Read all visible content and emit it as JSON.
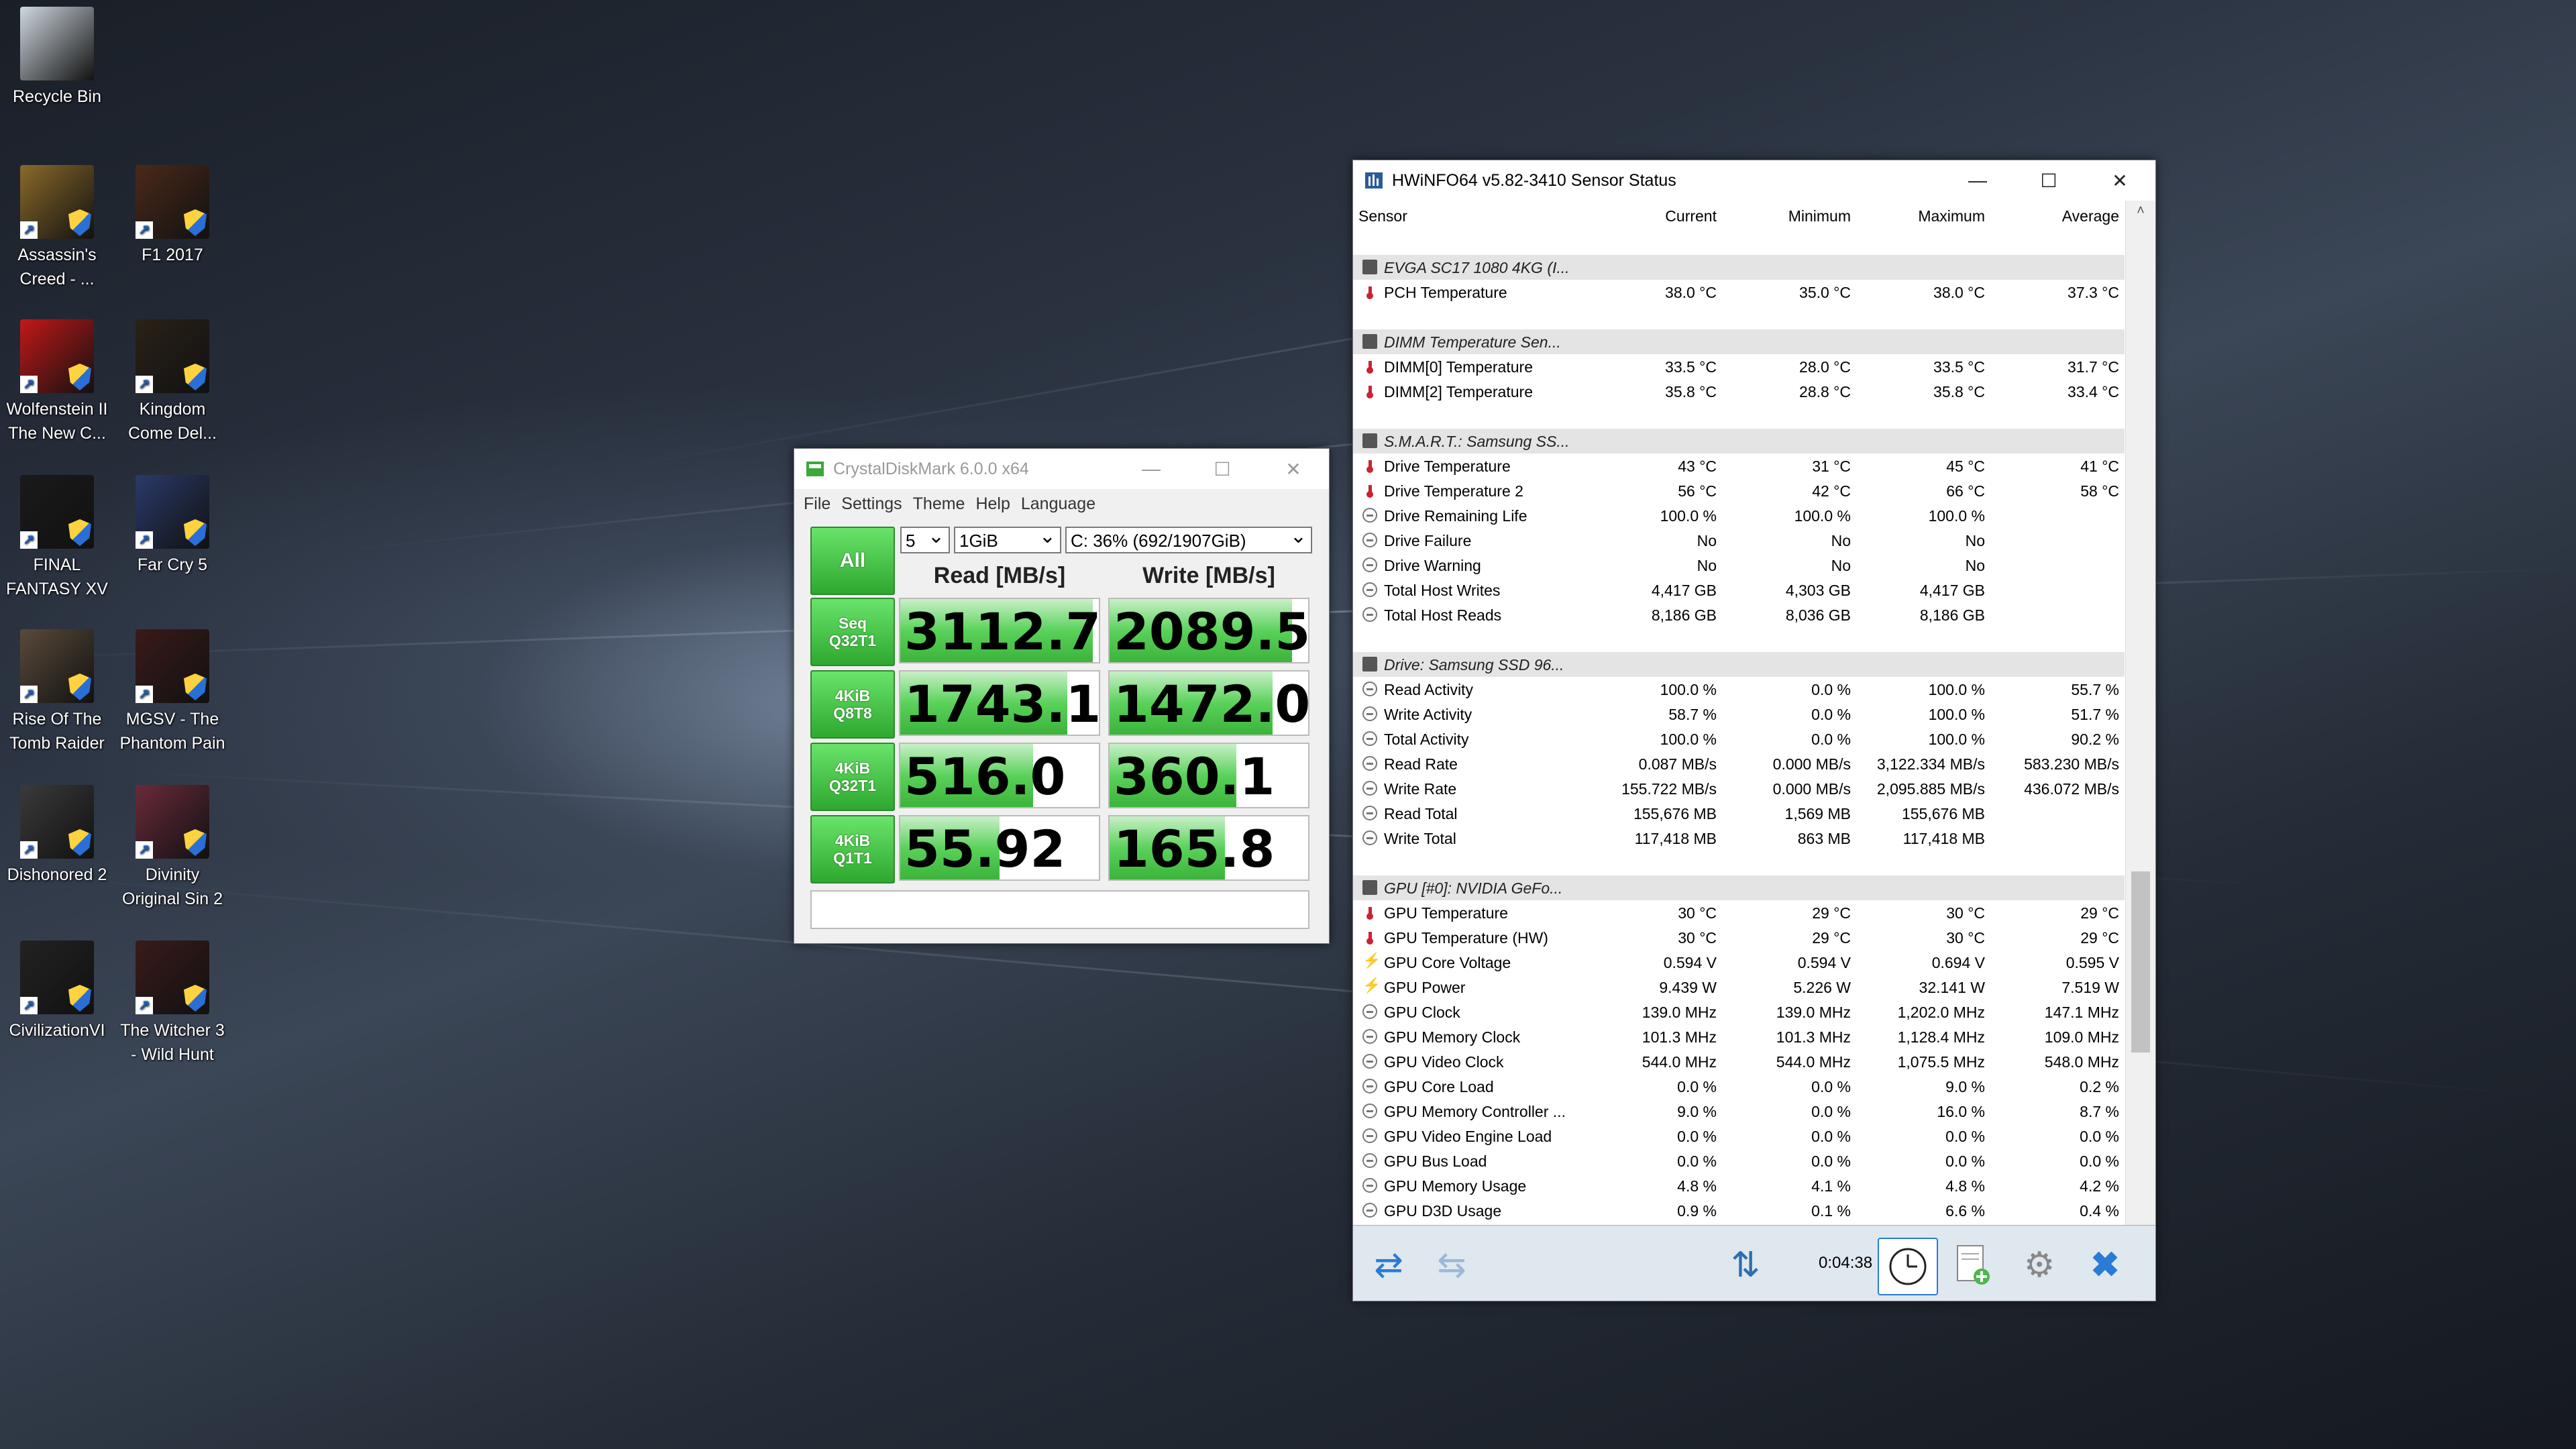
{
  "desktop": {
    "icons": [
      {
        "label": "Recycle Bin",
        "color": "#cfd8e0"
      },
      {
        "label": "Assassin's Creed - ...",
        "color": "#8a6a2a"
      },
      {
        "label": "F1 2017",
        "color": "#4a2a1a"
      },
      {
        "label": "Wolfenstein II The New C...",
        "color": "#c21818"
      },
      {
        "label": "Kingdom Come Del...",
        "color": "#2a2218"
      },
      {
        "label": "FINAL FANTASY XV",
        "color": "#1a1a1a"
      },
      {
        "label": "Far Cry 5",
        "color": "#2a3a6a"
      },
      {
        "label": "Rise Of The Tomb Raider",
        "color": "#5a4a3a"
      },
      {
        "label": "MGSV - The Phantom Pain",
        "color": "#3a1a1a"
      },
      {
        "label": "Dishonored 2",
        "color": "#3a3a3a"
      },
      {
        "label": "Divinity Original Sin 2",
        "color": "#6a2a3a"
      },
      {
        "label": "CivilizationVI",
        "color": "#222222"
      },
      {
        "label": "The Witcher 3 - Wild Hunt",
        "color": "#3a1a1a"
      }
    ]
  },
  "cdm": {
    "title": "CrystalDiskMark 6.0.0 x64",
    "menu": [
      "File",
      "Settings",
      "Theme",
      "Help",
      "Language"
    ],
    "all_label": "All",
    "count": "5",
    "size": "1GiB",
    "drive": "C: 36% (692/1907GiB)",
    "read_header": "Read [MB/s]",
    "write_header": "Write [MB/s]",
    "tests": [
      {
        "l1": "Seq",
        "l2": "Q32T1",
        "read": "3112.7",
        "write": "2089.5",
        "read_fill": 0.97,
        "write_fill": 0.92
      },
      {
        "l1": "4KiB",
        "l2": "Q8T8",
        "read": "1743.1",
        "write": "1472.0",
        "read_fill": 0.84,
        "write_fill": 0.82
      },
      {
        "l1": "4KiB",
        "l2": "Q32T1",
        "read": "516.0",
        "write": "360.1",
        "read_fill": 0.67,
        "write_fill": 0.64
      },
      {
        "l1": "4KiB",
        "l2": "Q1T1",
        "read": "55.92",
        "write": "165.8",
        "read_fill": 0.5,
        "write_fill": 0.58
      }
    ]
  },
  "hw": {
    "title": "HWiNFO64 v5.82-3410 Sensor Status",
    "columns": [
      "Sensor",
      "Current",
      "Minimum",
      "Maximum",
      "Average"
    ],
    "rows": [
      {
        "type": "blank"
      },
      {
        "type": "group",
        "name": "EVGA SC17 1080 4KG (I..."
      },
      {
        "icon": "therm",
        "name": "PCH Temperature",
        "v": [
          "38.0 °C",
          "35.0 °C",
          "38.0 °C",
          "37.3 °C"
        ]
      },
      {
        "type": "blank"
      },
      {
        "type": "group",
        "name": "DIMM Temperature Sen..."
      },
      {
        "icon": "therm",
        "name": "DIMM[0] Temperature",
        "v": [
          "33.5 °C",
          "28.0 °C",
          "33.5 °C",
          "31.7 °C"
        ]
      },
      {
        "icon": "therm",
        "name": "DIMM[2] Temperature",
        "v": [
          "35.8 °C",
          "28.8 °C",
          "35.8 °C",
          "33.4 °C"
        ]
      },
      {
        "type": "blank"
      },
      {
        "type": "group",
        "name": "S.M.A.R.T.: Samsung SS..."
      },
      {
        "icon": "therm",
        "name": "Drive Temperature",
        "v": [
          "43 °C",
          "31 °C",
          "45 °C",
          "41 °C"
        ]
      },
      {
        "icon": "therm",
        "name": "Drive Temperature 2",
        "v": [
          "56 °C",
          "42 °C",
          "66 °C",
          "58 °C"
        ]
      },
      {
        "icon": "circ",
        "name": "Drive Remaining Life",
        "v": [
          "100.0 %",
          "100.0 %",
          "100.0 %",
          ""
        ]
      },
      {
        "icon": "circ",
        "name": "Drive Failure",
        "v": [
          "No",
          "No",
          "No",
          ""
        ]
      },
      {
        "icon": "circ",
        "name": "Drive Warning",
        "v": [
          "No",
          "No",
          "No",
          ""
        ]
      },
      {
        "icon": "circ",
        "name": "Total Host Writes",
        "v": [
          "4,417 GB",
          "4,303 GB",
          "4,417 GB",
          ""
        ]
      },
      {
        "icon": "circ",
        "name": "Total Host Reads",
        "v": [
          "8,186 GB",
          "8,036 GB",
          "8,186 GB",
          ""
        ]
      },
      {
        "type": "blank"
      },
      {
        "type": "group",
        "name": "Drive: Samsung SSD 96..."
      },
      {
        "icon": "circ",
        "name": "Read Activity",
        "v": [
          "100.0 %",
          "0.0 %",
          "100.0 %",
          "55.7 %"
        ]
      },
      {
        "icon": "circ",
        "name": "Write Activity",
        "v": [
          "58.7 %",
          "0.0 %",
          "100.0 %",
          "51.7 %"
        ]
      },
      {
        "icon": "circ",
        "name": "Total Activity",
        "v": [
          "100.0 %",
          "0.0 %",
          "100.0 %",
          "90.2 %"
        ]
      },
      {
        "icon": "circ",
        "name": "Read Rate",
        "v": [
          "0.087 MB/s",
          "0.000 MB/s",
          "3,122.334 MB/s",
          "583.230 MB/s"
        ]
      },
      {
        "icon": "circ",
        "name": "Write Rate",
        "v": [
          "155.722 MB/s",
          "0.000 MB/s",
          "2,095.885 MB/s",
          "436.072 MB/s"
        ]
      },
      {
        "icon": "circ",
        "name": "Read Total",
        "v": [
          "155,676 MB",
          "1,569 MB",
          "155,676 MB",
          ""
        ]
      },
      {
        "icon": "circ",
        "name": "Write Total",
        "v": [
          "117,418 MB",
          "863 MB",
          "117,418 MB",
          ""
        ]
      },
      {
        "type": "blank"
      },
      {
        "type": "group",
        "name": "GPU [#0]: NVIDIA GeFo..."
      },
      {
        "icon": "therm",
        "name": "GPU Temperature",
        "v": [
          "30 °C",
          "29 °C",
          "30 °C",
          "29 °C"
        ]
      },
      {
        "icon": "therm",
        "name": "GPU Temperature (HW)",
        "v": [
          "30 °C",
          "29 °C",
          "30 °C",
          "29 °C"
        ]
      },
      {
        "icon": "bolt",
        "name": "GPU Core Voltage",
        "v": [
          "0.594 V",
          "0.594 V",
          "0.694 V",
          "0.595 V"
        ]
      },
      {
        "icon": "bolt",
        "name": "GPU Power",
        "v": [
          "9.439 W",
          "5.226 W",
          "32.141 W",
          "7.519 W"
        ]
      },
      {
        "icon": "circ",
        "name": "GPU Clock",
        "v": [
          "139.0 MHz",
          "139.0 MHz",
          "1,202.0 MHz",
          "147.1 MHz"
        ]
      },
      {
        "icon": "circ",
        "name": "GPU Memory Clock",
        "v": [
          "101.3 MHz",
          "101.3 MHz",
          "1,128.4 MHz",
          "109.0 MHz"
        ]
      },
      {
        "icon": "circ",
        "name": "GPU Video Clock",
        "v": [
          "544.0 MHz",
          "544.0 MHz",
          "1,075.5 MHz",
          "548.0 MHz"
        ]
      },
      {
        "icon": "circ",
        "name": "GPU Core Load",
        "v": [
          "0.0 %",
          "0.0 %",
          "9.0 %",
          "0.2 %"
        ]
      },
      {
        "icon": "circ",
        "name": "GPU Memory Controller ...",
        "v": [
          "9.0 %",
          "0.0 %",
          "16.0 %",
          "8.7 %"
        ]
      },
      {
        "icon": "circ",
        "name": "GPU Video Engine Load",
        "v": [
          "0.0 %",
          "0.0 %",
          "0.0 %",
          "0.0 %"
        ]
      },
      {
        "icon": "circ",
        "name": "GPU Bus Load",
        "v": [
          "0.0 %",
          "0.0 %",
          "0.0 %",
          "0.0 %"
        ]
      },
      {
        "icon": "circ",
        "name": "GPU Memory Usage",
        "v": [
          "4.8 %",
          "4.1 %",
          "4.8 %",
          "4.2 %"
        ]
      },
      {
        "icon": "circ",
        "name": "GPU D3D Usage",
        "v": [
          "0.9 %",
          "0.1 %",
          "6.6 %",
          "0.4 %"
        ]
      }
    ],
    "timer": "0:04:38"
  }
}
